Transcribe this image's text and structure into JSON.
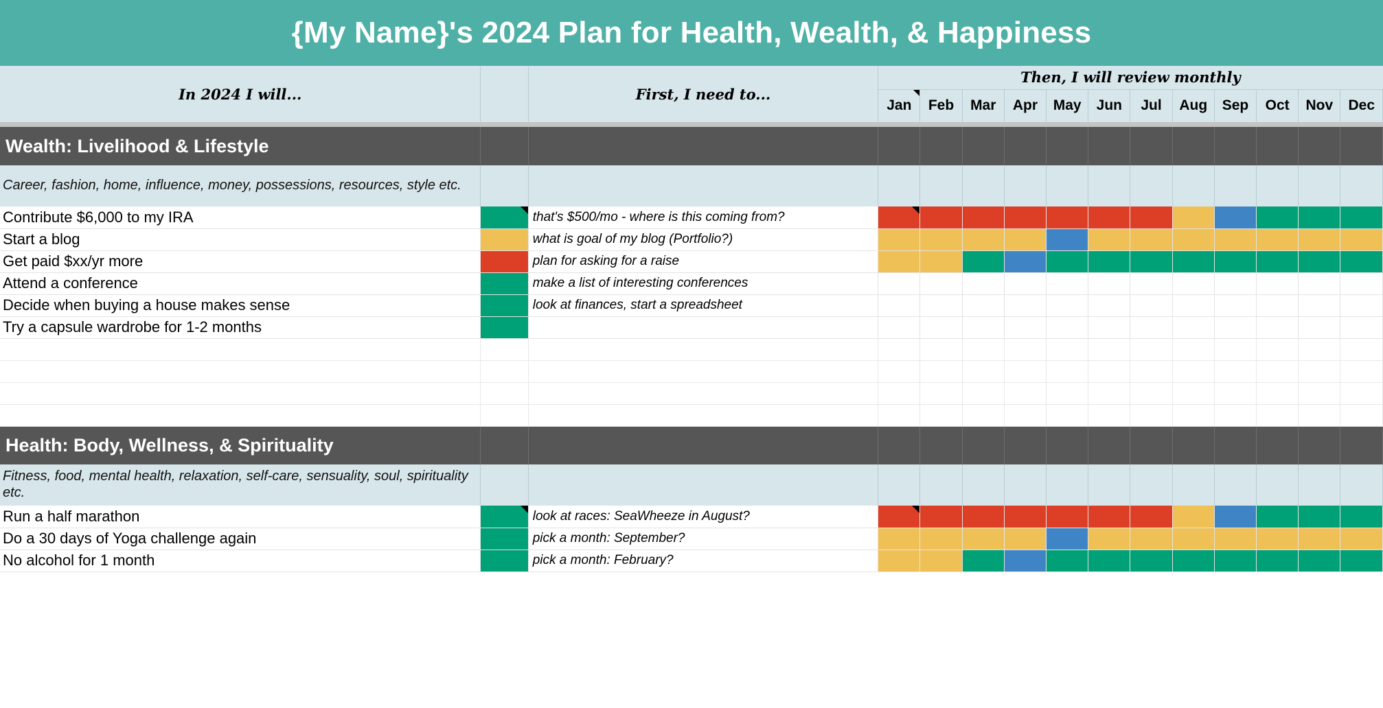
{
  "banner": {
    "title": "{My Name}'s 2024 Plan for Health, Wealth, & Happiness"
  },
  "colors": {
    "banner_teal": "#4eb0a6",
    "header_blue": "#d7e6ea",
    "section_gray": "#565656",
    "green": "#00a176",
    "amber": "#efc056",
    "red": "#dc3e26",
    "blue": "#3f85c6",
    "white": "#ffffff"
  },
  "headers": {
    "goal_column": "In 2024 I will...",
    "status_column": "",
    "first_column": "First, I need to...",
    "review_title": "Then, I will review monthly",
    "months": [
      "Jan",
      "Feb",
      "Mar",
      "Apr",
      "May",
      "Jun",
      "Jul",
      "Aug",
      "Sep",
      "Oct",
      "Nov",
      "Dec"
    ]
  },
  "sections": [
    {
      "name": "wealth",
      "title": "Wealth: Livelihood & Lifestyle",
      "description": "Career, fashion, home, influence, money, possessions, resources, style etc.",
      "goals": [
        {
          "goal": "Contribute $6,000 to my IRA",
          "status_color": "#00a176",
          "status_comment": true,
          "first_step": "that's $500/mo - where is this coming from?",
          "months": [
            "#dc3e26",
            "#dc3e26",
            "#dc3e26",
            "#dc3e26",
            "#dc3e26",
            "#dc3e26",
            "#dc3e26",
            "#efc056",
            "#3f85c6",
            "#00a176",
            "#00a176",
            "#00a176"
          ],
          "month_comment_index": 0
        },
        {
          "goal": "Start a blog",
          "status_color": "#efc056",
          "status_comment": false,
          "first_step": "what is goal of my blog (Portfolio?)",
          "months": [
            "#efc056",
            "#efc056",
            "#efc056",
            "#efc056",
            "#3f85c6",
            "#efc056",
            "#efc056",
            "#efc056",
            "#efc056",
            "#efc056",
            "#efc056",
            "#efc056"
          ],
          "month_comment_index": -1
        },
        {
          "goal": "Get paid $xx/yr more",
          "status_color": "#dc3e26",
          "status_comment": false,
          "first_step": "plan for asking for a raise",
          "months": [
            "#efc056",
            "#efc056",
            "#00a176",
            "#3f85c6",
            "#00a176",
            "#00a176",
            "#00a176",
            "#00a176",
            "#00a176",
            "#00a176",
            "#00a176",
            "#00a176"
          ],
          "month_comment_index": -1
        },
        {
          "goal": "Attend a conference",
          "status_color": "#00a176",
          "status_comment": false,
          "first_step": "make a list of interesting conferences",
          "months": [
            "",
            "",
            "",
            "",
            "",
            "",
            "",
            "",
            "",
            "",
            "",
            ""
          ],
          "month_comment_index": -1
        },
        {
          "goal": "Decide when buying a house makes sense",
          "status_color": "#00a176",
          "status_comment": false,
          "first_step": "look at finances, start a spreadsheet",
          "months": [
            "",
            "",
            "",
            "",
            "",
            "",
            "",
            "",
            "",
            "",
            "",
            ""
          ],
          "month_comment_index": -1
        },
        {
          "goal": "Try a capsule wardrobe for 1-2 months",
          "status_color": "#00a176",
          "status_comment": false,
          "first_step": "",
          "months": [
            "",
            "",
            "",
            "",
            "",
            "",
            "",
            "",
            "",
            "",
            "",
            ""
          ],
          "month_comment_index": -1
        }
      ],
      "empty_rows": 4
    },
    {
      "name": "health",
      "title": "Health: Body, Wellness, & Spirituality",
      "description": "Fitness, food, mental health, relaxation, self-care, sensuality, soul, spirituality etc.",
      "goals": [
        {
          "goal": "Run a half marathon",
          "status_color": "#00a176",
          "status_comment": true,
          "first_step": "look at races: SeaWheeze in August?",
          "months": [
            "#dc3e26",
            "#dc3e26",
            "#dc3e26",
            "#dc3e26",
            "#dc3e26",
            "#dc3e26",
            "#dc3e26",
            "#efc056",
            "#3f85c6",
            "#00a176",
            "#00a176",
            "#00a176"
          ],
          "month_comment_index": 0
        },
        {
          "goal": "Do a 30 days of Yoga challenge again",
          "status_color": "#00a176",
          "status_comment": false,
          "first_step": "pick a month: September?",
          "months": [
            "#efc056",
            "#efc056",
            "#efc056",
            "#efc056",
            "#3f85c6",
            "#efc056",
            "#efc056",
            "#efc056",
            "#efc056",
            "#efc056",
            "#efc056",
            "#efc056"
          ],
          "month_comment_index": -1
        },
        {
          "goal": "No alcohol for 1 month",
          "status_color": "#00a176",
          "status_comment": false,
          "first_step": "pick a month: February?",
          "months": [
            "#efc056",
            "#efc056",
            "#00a176",
            "#3f85c6",
            "#00a176",
            "#00a176",
            "#00a176",
            "#00a176",
            "#00a176",
            "#00a176",
            "#00a176",
            "#00a176"
          ],
          "month_comment_index": -1
        }
      ],
      "empty_rows": 0
    }
  ]
}
